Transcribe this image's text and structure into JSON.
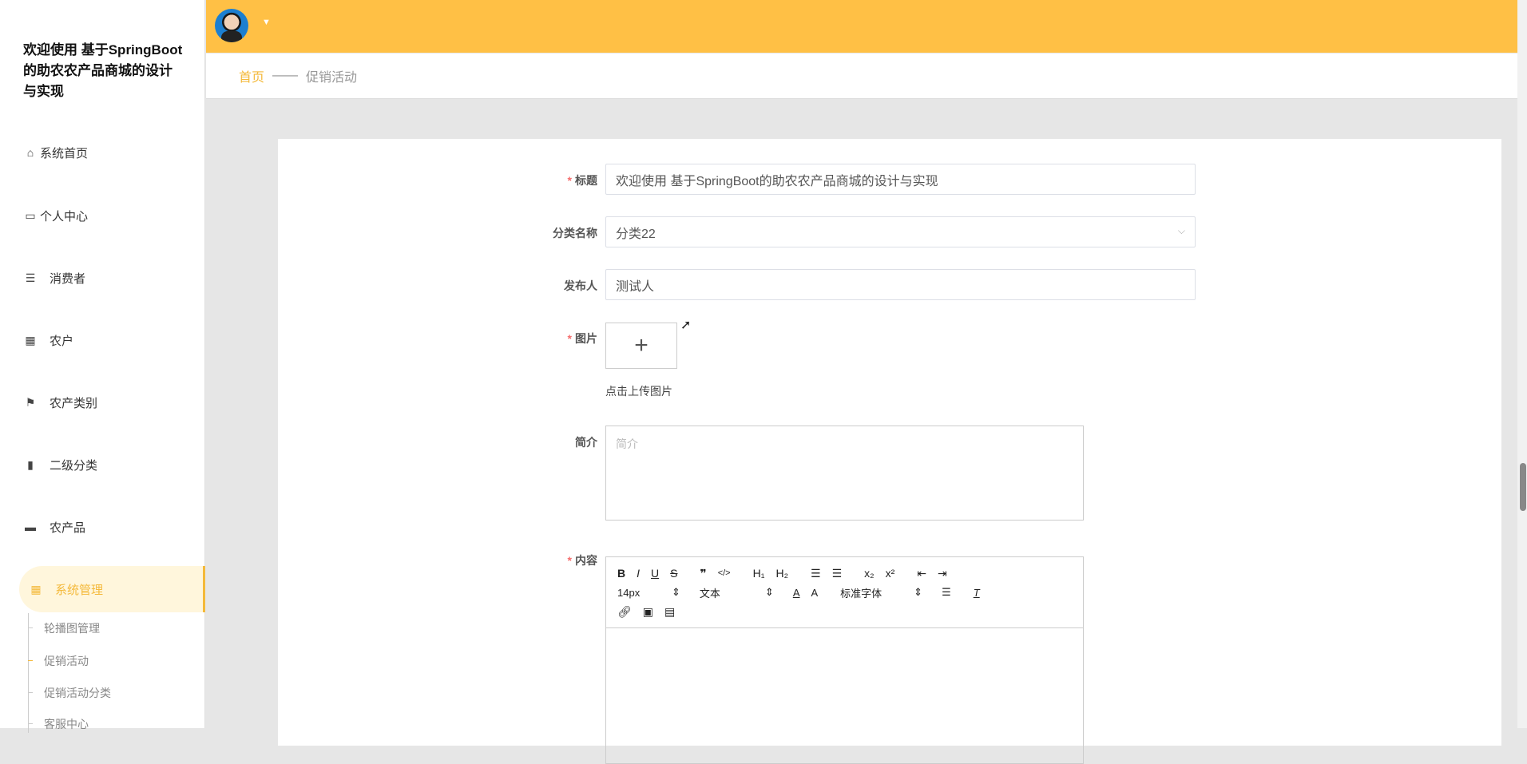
{
  "brand": {
    "title": "欢迎使用 基于SpringBoot的助农农产品商城的设计与实现"
  },
  "nav": {
    "items": [
      {
        "label": "系统首页",
        "icon": "home-icon"
      },
      {
        "label": "个人中心",
        "icon": "card-icon"
      },
      {
        "label": "消费者",
        "icon": "list-icon"
      },
      {
        "label": "农户",
        "icon": "grid-icon"
      },
      {
        "label": "农产类别",
        "icon": "flag-icon"
      },
      {
        "label": "二级分类",
        "icon": "bar-chart-icon"
      },
      {
        "label": "农产品",
        "icon": "shop-icon"
      },
      {
        "label": "系统管理",
        "icon": "grid-icon"
      }
    ],
    "sub_items": [
      "轮播图管理",
      "促销活动",
      "促销活动分类",
      "客服中心"
    ]
  },
  "breadcrumb": {
    "home": "首页",
    "sep": "——",
    "current": "促销活动"
  },
  "form": {
    "title_label": "标题",
    "title_value": "欢迎使用 基于SpringBoot的助农农产品商城的设计与实现",
    "category_label": "分类名称",
    "category_value": "分类22",
    "publisher_label": "发布人",
    "publisher_value": "测试人",
    "image_label": "图片",
    "upload_tip": "点击上传图片",
    "intro_label": "简介",
    "intro_placeholder": "简介",
    "content_label": "内容",
    "toolbar": {
      "font_size": "14px",
      "heading": "文本",
      "font_family": "标准字体"
    }
  }
}
